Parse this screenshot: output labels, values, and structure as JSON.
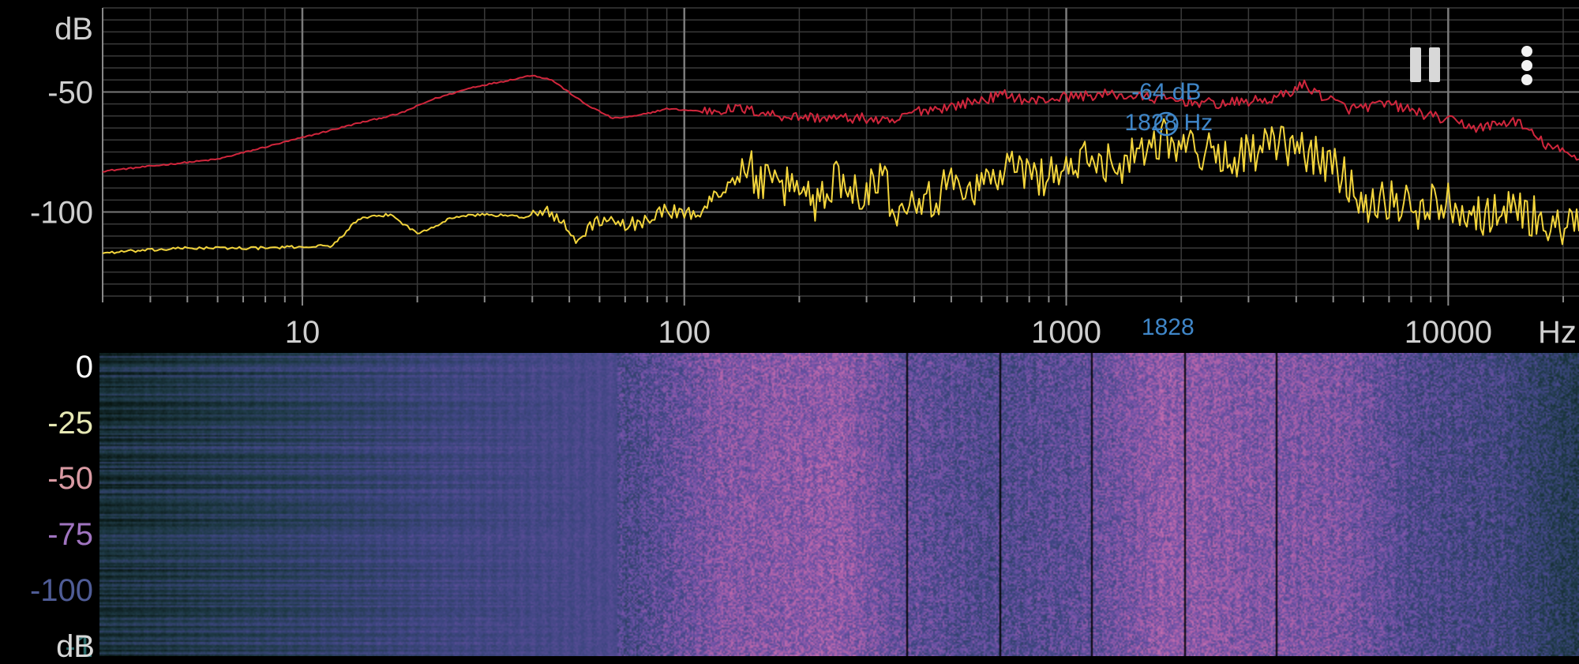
{
  "spectrum": {
    "db_unit": "dB",
    "hz_unit": "Hz",
    "y_tick_labels": [
      "-50",
      "-100"
    ],
    "x_tick_labels": [
      "10",
      "100",
      "1000",
      "10000"
    ],
    "cursor": {
      "db_label": "-64 dB",
      "hz_label": "1828 Hz",
      "axis_label": "1828",
      "freq_hz": 1828,
      "db": -64
    },
    "colors": {
      "peak_hold": "#d0263c",
      "current": "#f2d43c",
      "cursor": "#3f86c8",
      "grid": "#3a3a3a",
      "label": "#cfcfcf"
    }
  },
  "spectrogram": {
    "tick_labels": [
      "0",
      "-25",
      "-50",
      "-75",
      "-100",
      "-1"
    ],
    "unit": "dB",
    "tick_colors": [
      "#ffffff",
      "#e6e8b4",
      "#d99aa3",
      "#a074c0",
      "#4f5c96",
      "#2e6d6c"
    ]
  },
  "controls": {
    "pause_icon": "pause-icon",
    "menu_icon": "more-vert-icon"
  },
  "chart_data": {
    "type": "line",
    "xscale": "log",
    "xlim": [
      3,
      22000
    ],
    "ylim": [
      -135,
      -15
    ],
    "xlabel": "Hz",
    "ylabel": "dB",
    "series": [
      {
        "color": "#d0263c",
        "x": [
          3,
          6,
          10,
          14,
          18,
          22,
          28,
          35,
          40,
          45,
          55,
          65,
          75,
          90,
          110,
          140,
          180,
          250,
          300,
          350,
          400,
          500,
          700,
          800,
          1000,
          1300,
          1800,
          2500,
          3500,
          4200,
          4600,
          5500,
          7000,
          9000,
          12000,
          15000,
          18000,
          22000
        ],
        "y": [
          -83,
          -78,
          -69,
          -63,
          -59,
          -53,
          -48,
          -45,
          -43,
          -45,
          -55,
          -61,
          -60,
          -57,
          -58,
          -57,
          -60,
          -61,
          -61,
          -63,
          -58,
          -56,
          -51,
          -54,
          -52,
          -51,
          -53,
          -55,
          -53,
          -47,
          -51,
          -57,
          -55,
          -60,
          -65,
          -62,
          -72,
          -78
        ]
      },
      {
        "color": "#f2d43c",
        "x": [
          3,
          5,
          8,
          12,
          14,
          17,
          20,
          25,
          30,
          38,
          45,
          52,
          60,
          70,
          80,
          90,
          100,
          110,
          130,
          150,
          170,
          200,
          220,
          250,
          300,
          330,
          350,
          400,
          450,
          500,
          600,
          700,
          800,
          900,
          1000,
          1200,
          1400,
          1600,
          1828,
          2000,
          2500,
          3000,
          3500,
          4500,
          5500,
          6000,
          7000,
          8000,
          10000,
          12000,
          15000,
          18000,
          22000
        ],
        "y": [
          -117,
          -115,
          -115,
          -114,
          -103,
          -101,
          -109,
          -102,
          -101,
          -102,
          -100,
          -112,
          -103,
          -106,
          -103,
          -99,
          -101,
          -100,
          -88,
          -83,
          -91,
          -88,
          -96,
          -86,
          -91,
          -82,
          -99,
          -91,
          -95,
          -88,
          -89,
          -81,
          -85,
          -84,
          -82,
          -78,
          -80,
          -72,
          -68,
          -72,
          -77,
          -76,
          -72,
          -76,
          -87,
          -96,
          -94,
          -99,
          -95,
          -101,
          -98,
          -105,
          -108
        ]
      }
    ]
  }
}
